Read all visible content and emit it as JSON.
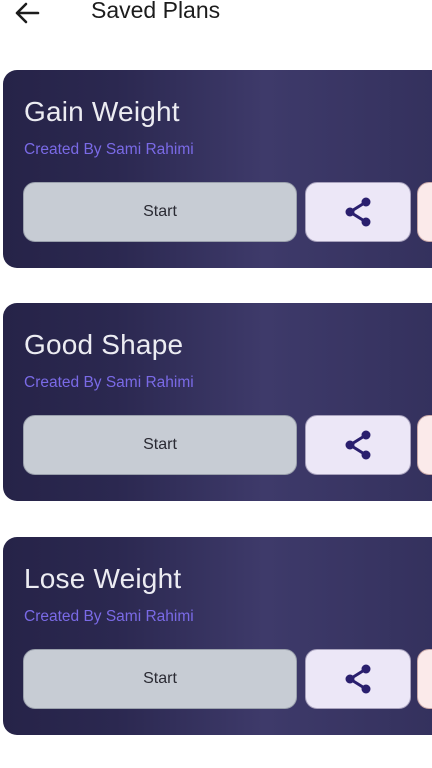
{
  "header": {
    "back_icon": "arrow-left-icon",
    "title": "Saved Plans"
  },
  "plans": [
    {
      "title": "Gain Weight",
      "creator": "Created By Sami Rahimi",
      "start_label": "Start",
      "share_icon": "share-icon"
    },
    {
      "title": "Good Shape",
      "creator": "Created By Sami Rahimi",
      "start_label": "Start",
      "share_icon": "share-icon"
    },
    {
      "title": "Lose Weight",
      "creator": "Created By Sami Rahimi",
      "start_label": "Start",
      "share_icon": "share-icon"
    }
  ],
  "colors": {
    "card_background": "#2e2b55",
    "creator_text": "#7a6ae6",
    "start_button": "#c7ccd4",
    "share_button": "#ece7f7",
    "share_icon": "#2a1f6e",
    "extra_button": "#fbeaea"
  }
}
